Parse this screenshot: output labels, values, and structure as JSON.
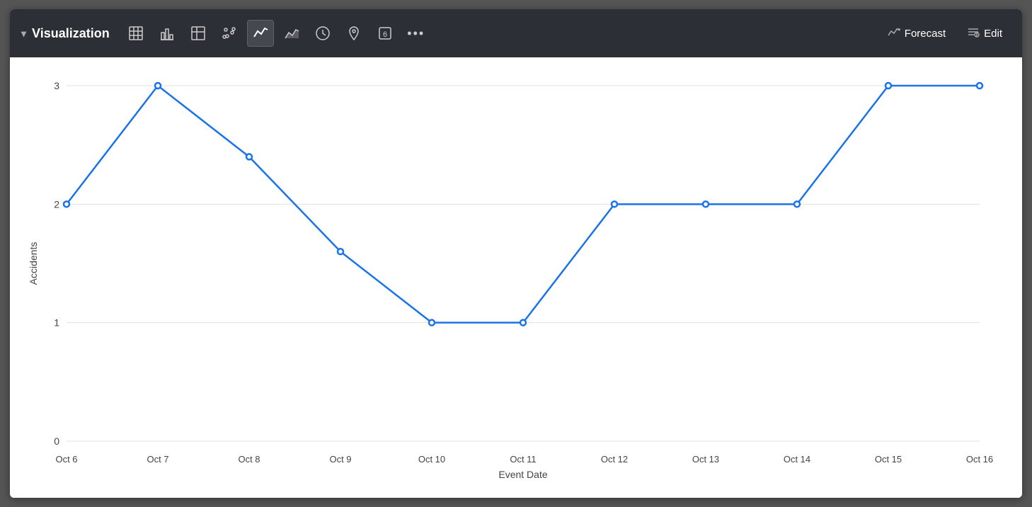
{
  "toolbar": {
    "title": "Visualization",
    "chevron": "▾",
    "icons": [
      {
        "name": "table-icon",
        "symbol": "⊞",
        "active": false
      },
      {
        "name": "bar-chart-icon",
        "symbol": "▦",
        "active": false
      },
      {
        "name": "table2-icon",
        "symbol": "⊟",
        "active": false
      },
      {
        "name": "scatter-icon",
        "symbol": "⁘",
        "active": false
      },
      {
        "name": "line-chart-icon",
        "symbol": "〜",
        "active": true
      },
      {
        "name": "area-chart-icon",
        "symbol": "◰",
        "active": false
      },
      {
        "name": "clock-icon",
        "symbol": "⊙",
        "active": false
      },
      {
        "name": "pin-icon",
        "symbol": "⊕",
        "active": false
      },
      {
        "name": "number-icon",
        "symbol": "6",
        "active": false
      },
      {
        "name": "more-icon",
        "symbol": "•••",
        "active": false
      }
    ],
    "forecast_label": "Forecast",
    "edit_label": "Edit"
  },
  "chart": {
    "y_axis_label": "Accidents",
    "x_axis_label": "Event Date",
    "y_ticks": [
      0,
      1,
      2,
      3
    ],
    "x_labels": [
      "Oct 6",
      "Oct 7",
      "Oct 8",
      "Oct 9",
      "Oct 10",
      "Oct 11",
      "Oct 12",
      "Oct 13",
      "Oct 14",
      "Oct 15",
      "Oct 16"
    ],
    "data_points": [
      {
        "date": "Oct 6",
        "value": 2
      },
      {
        "date": "Oct 7",
        "value": 3
      },
      {
        "date": "Oct 8",
        "value": 2.4
      },
      {
        "date": "Oct 9",
        "value": 1.6
      },
      {
        "date": "Oct 10",
        "value": 1
      },
      {
        "date": "Oct 11",
        "value": 1
      },
      {
        "date": "Oct 12",
        "value": 2
      },
      {
        "date": "Oct 13",
        "value": 2
      },
      {
        "date": "Oct 14",
        "value": 2
      },
      {
        "date": "Oct 15",
        "value": 3
      },
      {
        "date": "Oct 16",
        "value": 3
      }
    ],
    "line_color": "#1a73e8",
    "grid_color": "#e0e0e0",
    "axis_color": "#ccc",
    "text_color": "#444"
  }
}
